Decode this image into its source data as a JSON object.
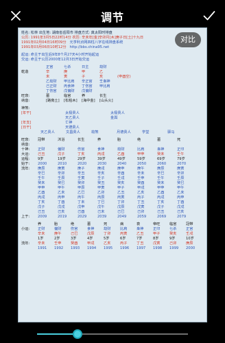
{
  "header": {
    "title": "调节"
  },
  "compare_label": "对比",
  "slider": {
    "value": 0.27
  },
  "doc": {
    "name_line": "姓名: 松林    出生地: 湖南省岳阳市    排盘方式: 真太阳时排盘",
    "gong_line": "公历: 1991年3月5日22时14分    农历: 辛未年[金]辛卯月[木]庚子日[土]十九日",
    "term1": "1991年02月04日16时09分",
    "term2": "1991年03月06日10时12分",
    "site1": "元亨利贞网四柱八字在线排盘系统",
    "site2": "http://bbs.china95.net",
    "qiyun": "起运: 命主于出生后9年8个月27天4小时开始起运",
    "jiaoyun": "交运: 命主于公历2000年12月3日开始交运",
    "shishen_top": [
      "正官",
      "七杀",
      "日主",
      "劫财"
    ],
    "qiankun_label": "乾造",
    "gan": [
      "辛",
      "庚",
      "甲",
      "乙"
    ],
    "zhi": [
      "未",
      "寅",
      "子",
      "亥"
    ],
    "empty_note": "(申酉空)",
    "cang1": [
      "乙劫财",
      "甲比肩",
      "辛正官",
      "壬枭神"
    ],
    "cang2": [
      "己正财",
      "丙食神",
      "丁伤官",
      "甲比肩"
    ],
    "cang3": [
      "丁伤官",
      "戊偏财",
      "戊偏财",
      ""
    ],
    "wangshuai_label": "旺衰:",
    "wangshuai": [
      "墓",
      "临官",
      "养",
      "长生"
    ],
    "nayin_label": "纳音:",
    "nayin": [
      "[路旁土]",
      "[松柏木]",
      "[海中金]",
      "[山头火]"
    ],
    "shensha_label": "神煞:",
    "nianzhu_label": "[年干]",
    "shensha_col2": [
      "太极贵人",
      "天乙贵人",
      "亡神",
      "天德贵人"
    ],
    "shensha_col4": [
      "太极贵人",
      "金舆"
    ],
    "nianzhi_label": "[年支]",
    "rizhi_label": "[日干]",
    "shensha_row2": [
      "天乙贵人",
      "文昌贵人",
      "劫煞",
      "月德贵人",
      "学堂",
      "驿马"
    ],
    "luck_labels": [
      "旺衰:",
      "纳音:",
      "十神:",
      "大运:",
      "运程:",
      "始于:",
      "流年:",
      "上于:"
    ],
    "luck_wangshuai": [
      "冠带",
      "沐浴",
      "长生",
      "养",
      "胎",
      "绝",
      "墓",
      "死"
    ],
    "luck_shishen": [
      "正财",
      "偏财",
      "伤官",
      "食神",
      "劫财",
      "比肩",
      "枭神",
      "正印"
    ],
    "luck_dayun": [
      "己丑",
      "戊子",
      "丁亥",
      "丙戌",
      "乙酉",
      "甲申",
      "癸未",
      "壬午"
    ],
    "luck_age": [
      "9岁",
      "19岁",
      "29岁",
      "39岁",
      "49岁",
      "59岁",
      "69岁",
      "79岁"
    ],
    "luck_start": [
      "2000",
      "2010",
      "2020",
      "2030",
      "2040",
      "2050",
      "2060",
      "2070"
    ],
    "liunian_cols": [
      [
        "庚辰",
        "辛巳",
        "壬午",
        "癸未",
        "甲申",
        "乙酉",
        "丙戌",
        "丁亥",
        "戊子",
        "己丑"
      ],
      [
        "庚寅",
        "辛卯",
        "壬辰",
        "癸巳",
        "甲午",
        "乙未",
        "丙申",
        "丁酉",
        "戊戌",
        "己亥"
      ],
      [
        "庚子",
        "辛丑",
        "壬寅",
        "癸卯",
        "甲辰",
        "乙巳",
        "丙午",
        "丁未",
        "戊申",
        "己酉"
      ],
      [
        "庚戌",
        "辛亥",
        "壬子",
        "癸丑",
        "甲寅",
        "乙卯",
        "丙辰",
        "丁巳",
        "戊午",
        "己未"
      ],
      [
        "庚申",
        "辛酉",
        "壬戌",
        "癸亥",
        "甲子",
        "乙丑",
        "丙寅",
        "丁卯",
        "戊辰",
        "己巳"
      ],
      [
        "庚午",
        "辛未",
        "壬申",
        "癸酉",
        "甲戌",
        "乙亥",
        "丙子",
        "丁丑",
        "戊寅",
        "己卯"
      ],
      [
        "庚辰",
        "辛巳",
        "壬午",
        "癸未",
        "甲申",
        "乙酉",
        "丙戌",
        "丁亥",
        "戊子",
        "己丑"
      ],
      [
        "庚寅",
        "辛卯",
        "壬辰",
        "癸巳",
        "甲午",
        "乙未",
        "丙申",
        "丁酉",
        "戊戌",
        "己亥"
      ]
    ],
    "end_years": [
      "2009",
      "2019",
      "2029",
      "2039",
      "2049",
      "2059",
      "2069",
      "2079"
    ],
    "xiaoyun_label": "小运:",
    "xiaoyun_ws": [
      "养",
      "胎",
      "绝",
      "墓",
      "死",
      "病",
      "衰",
      "帝旺",
      "临官",
      "冠带"
    ],
    "xiaoyun_ss": [
      "正财",
      "偏财",
      "伤官",
      "食神",
      "劫财",
      "比肩",
      "枭神",
      "正印",
      "七杀",
      "正官"
    ],
    "xiaoyun_gz": [
      "辛未",
      "庚午",
      "己巳",
      "戊辰",
      "丁卯",
      "丙寅",
      "乙丑",
      "甲子",
      "癸亥",
      "壬戌"
    ],
    "xiaoyun_age": [
      "1岁",
      "2岁",
      "3岁",
      "4岁",
      "5岁",
      "6岁",
      "7岁",
      "8岁",
      "9岁",
      "10岁"
    ],
    "liunian2_label": "流年:",
    "liunian2_gz": [
      "辛未",
      "壬申",
      "癸酉",
      "甲戌",
      "乙亥",
      "丙子",
      "丁丑",
      "戊寅",
      "己卯",
      "庚辰"
    ],
    "liunian2_years": [
      "1991",
      "1992",
      "1993",
      "1994",
      "1995",
      "1996",
      "1997",
      "1998",
      "1999",
      "2000"
    ]
  }
}
